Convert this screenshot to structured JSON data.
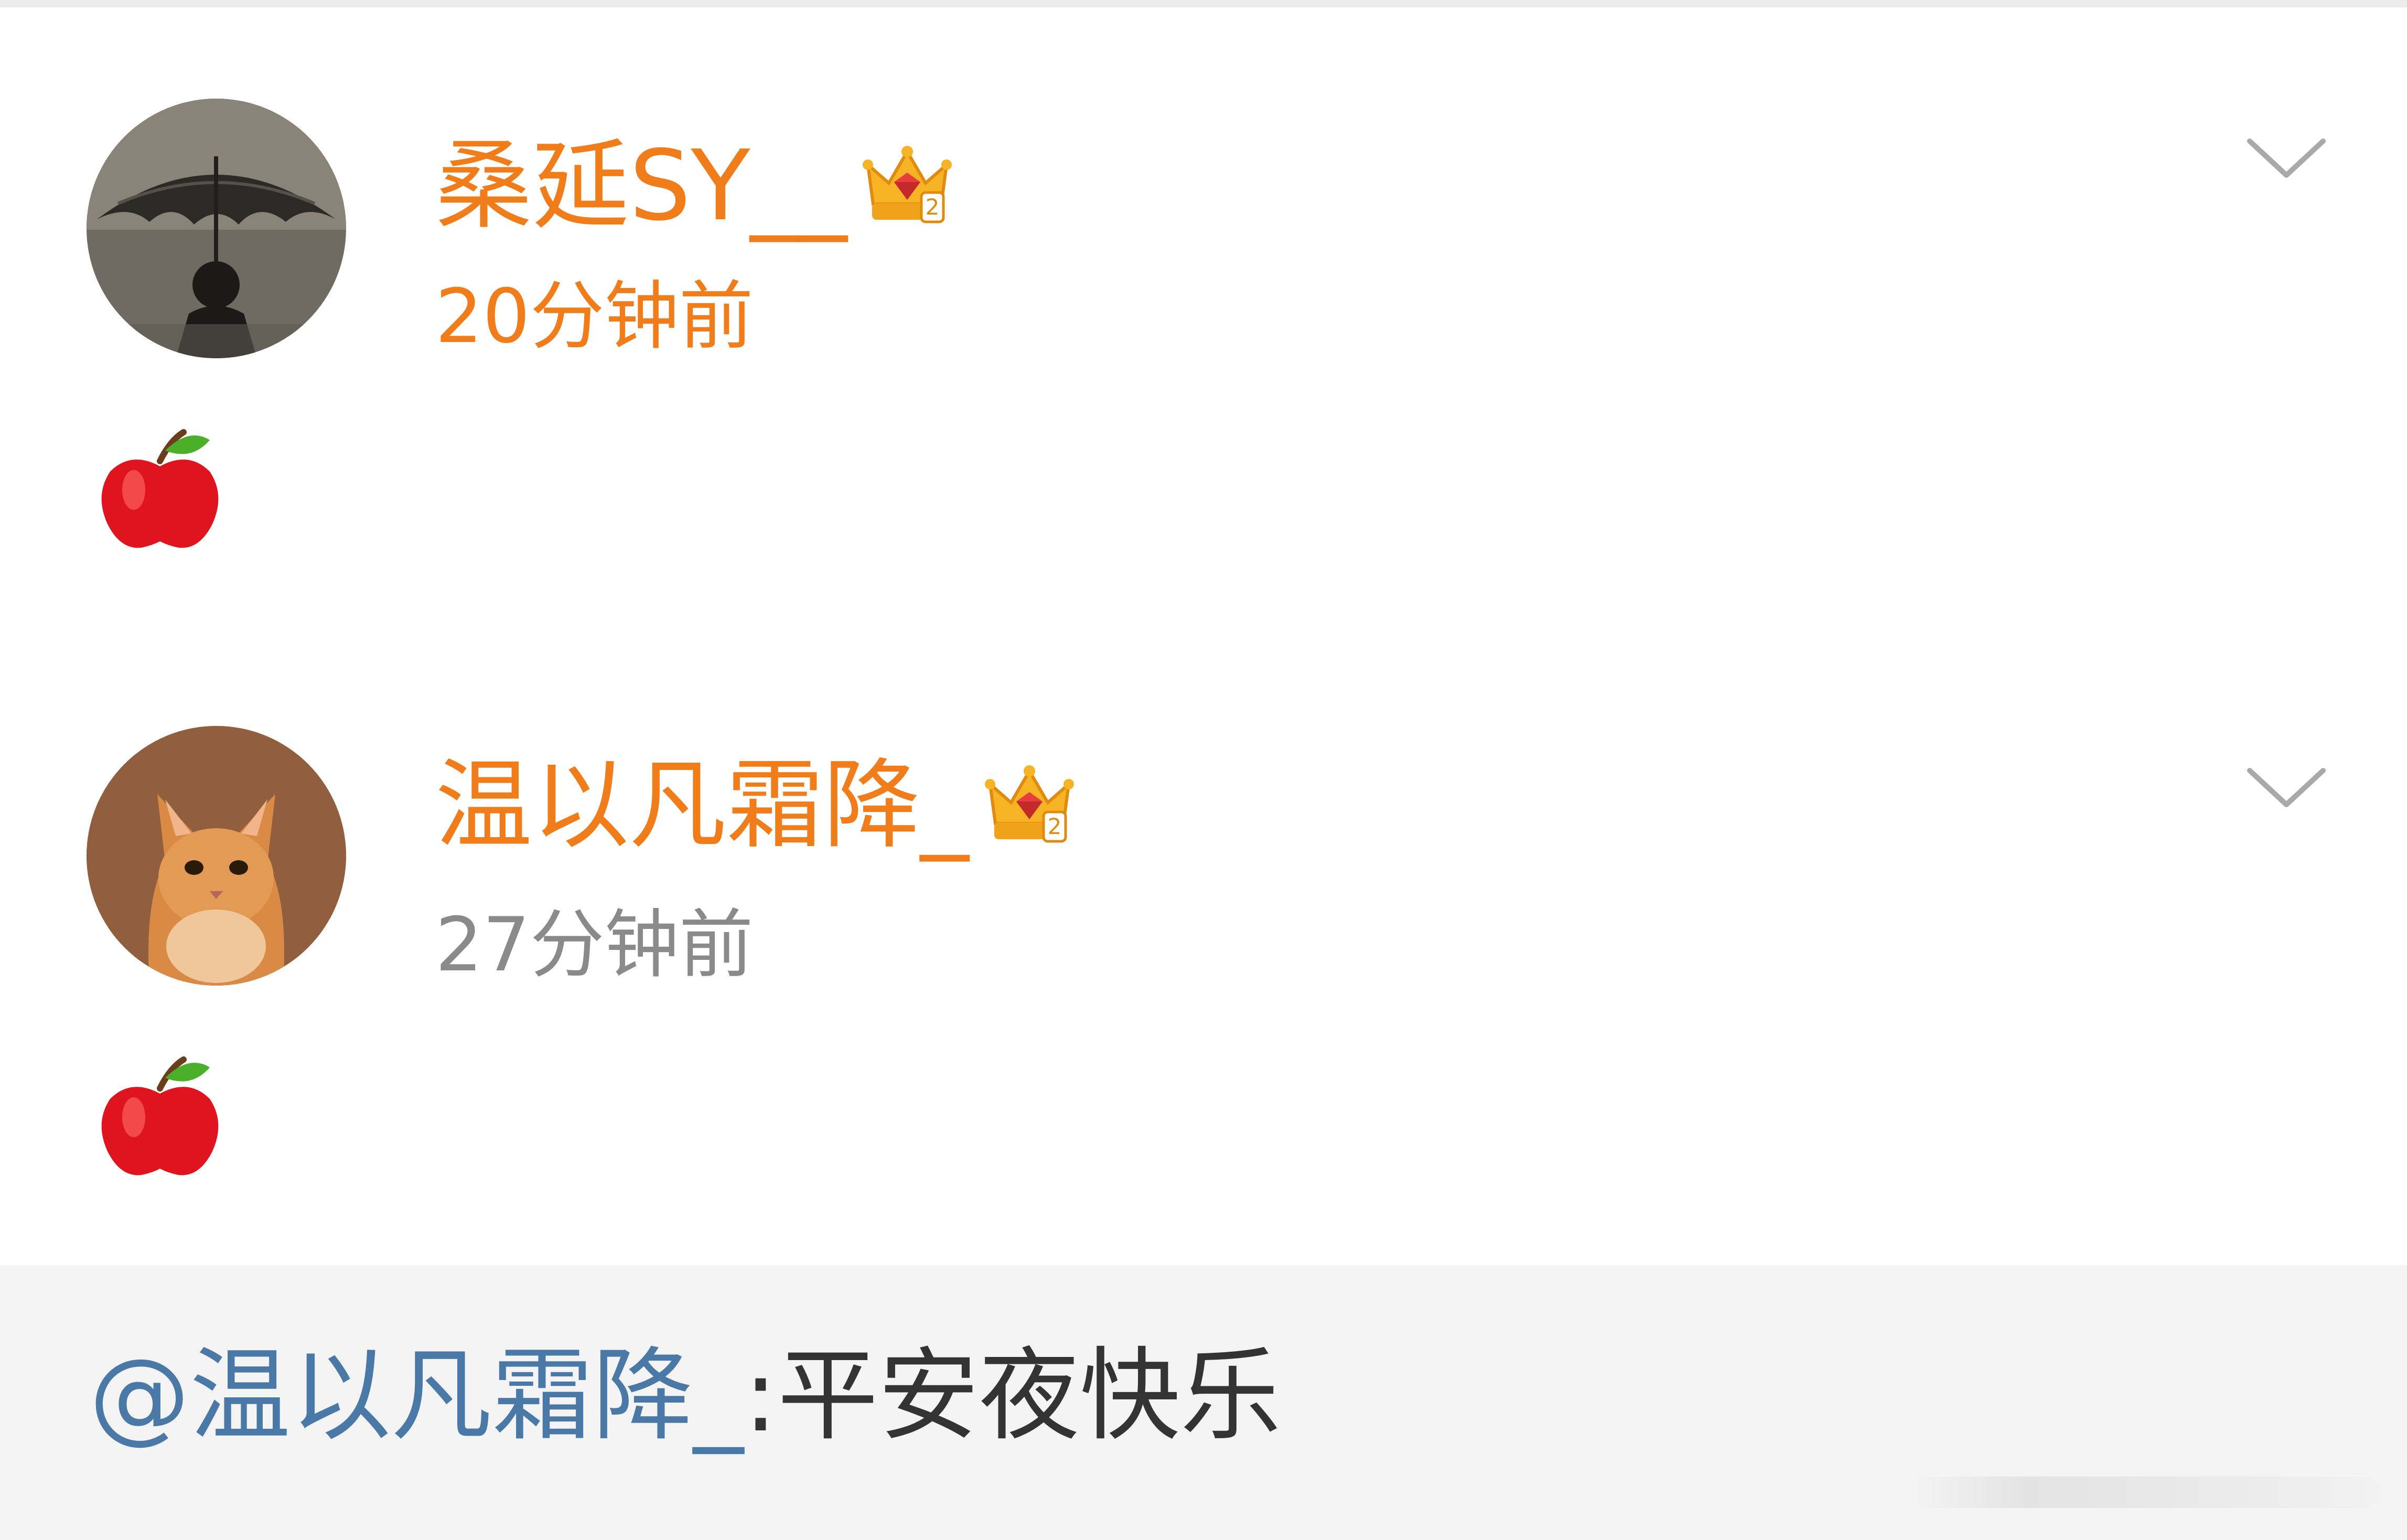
{
  "comments": [
    {
      "username": "桑延SY__",
      "timestamp": "20分钟前",
      "content_emoji": "apple-emoji",
      "badge_icon": "crown-icon",
      "avatar_icon": "umbrella-figure-avatar",
      "username_color": "#f07d1a",
      "timestamp_color": "#f07d1a"
    },
    {
      "username": "温以凡霜降_",
      "timestamp": "27分钟前",
      "content_emoji": "apple-emoji",
      "badge_icon": "crown-icon",
      "avatar_icon": "orange-cat-avatar",
      "username_color": "#f07d1a",
      "timestamp_color": "#8a8a8a"
    }
  ],
  "quote": {
    "mention": "@温以凡霜降_",
    "text": ":平安夜快乐",
    "mention_color": "#4a79a8"
  },
  "colors": {
    "accent_orange": "#f07d1a",
    "mention_blue": "#4a79a8",
    "quote_background": "#f4f4f4"
  }
}
